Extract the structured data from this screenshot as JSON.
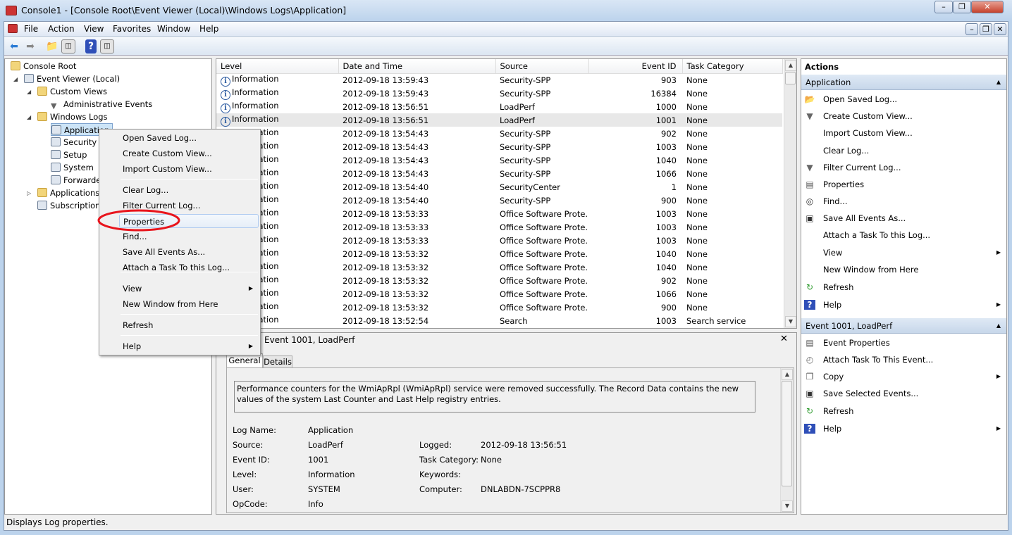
{
  "window": {
    "title": "Console1 - [Console Root\\Event Viewer (Local)\\Windows Logs\\Application]",
    "minimize": "–",
    "restore": "❐",
    "close": "✕"
  },
  "menubar": {
    "items": [
      "File",
      "Action",
      "View",
      "Favorites",
      "Window",
      "Help"
    ],
    "mdi": [
      "–",
      "❐",
      "✕"
    ]
  },
  "toolbar": {
    "buttons": [
      "back-icon",
      "forward-icon",
      "up-folder-icon",
      "show-hide-tree-icon",
      "help-icon",
      "show-hide-action-pane-icon"
    ]
  },
  "tree": {
    "items": [
      {
        "label": "Console Root",
        "icon": "folder-icon"
      },
      {
        "label": "Event Viewer (Local)",
        "icon": "event-viewer-icon"
      },
      {
        "label": "Custom Views",
        "icon": "folder-icon"
      },
      {
        "label": "Administrative Events",
        "icon": "filter-icon"
      },
      {
        "label": "Windows Logs",
        "icon": "folder-icon"
      },
      {
        "label": "Application",
        "icon": "log-icon"
      },
      {
        "label": "Security",
        "icon": "log-icon"
      },
      {
        "label": "Setup",
        "icon": "log-icon"
      },
      {
        "label": "System",
        "icon": "log-icon"
      },
      {
        "label": "Forwarded Events",
        "icon": "log-icon"
      },
      {
        "label": "Applications and Services Logs",
        "icon": "folder-icon"
      },
      {
        "label": "Subscriptions",
        "icon": "subscriptions-icon"
      }
    ]
  },
  "events": {
    "columns": [
      "Level",
      "Date and Time",
      "Source",
      "Event ID",
      "Task Category"
    ],
    "rows": [
      [
        "Information",
        "2012-09-18 13:59:43",
        "Security-SPP",
        "903",
        "None"
      ],
      [
        "Information",
        "2012-09-18 13:59:43",
        "Security-SPP",
        "16384",
        "None"
      ],
      [
        "Information",
        "2012-09-18 13:56:51",
        "LoadPerf",
        "1000",
        "None"
      ],
      [
        "Information",
        "2012-09-18 13:56:51",
        "LoadPerf",
        "1001",
        "None"
      ],
      [
        "Information",
        "2012-09-18 13:54:43",
        "Security-SPP",
        "902",
        "None"
      ],
      [
        "Information",
        "2012-09-18 13:54:43",
        "Security-SPP",
        "1003",
        "None"
      ],
      [
        "Information",
        "2012-09-18 13:54:43",
        "Security-SPP",
        "1040",
        "None"
      ],
      [
        "Information",
        "2012-09-18 13:54:43",
        "Security-SPP",
        "1066",
        "None"
      ],
      [
        "Information",
        "2012-09-18 13:54:40",
        "SecurityCenter",
        "1",
        "None"
      ],
      [
        "Information",
        "2012-09-18 13:54:40",
        "Security-SPP",
        "900",
        "None"
      ],
      [
        "Information",
        "2012-09-18 13:53:33",
        "Office Software Prote...",
        "1003",
        "None"
      ],
      [
        "Information",
        "2012-09-18 13:53:33",
        "Office Software Prote...",
        "1003",
        "None"
      ],
      [
        "Information",
        "2012-09-18 13:53:33",
        "Office Software Prote...",
        "1003",
        "None"
      ],
      [
        "Information",
        "2012-09-18 13:53:32",
        "Office Software Prote...",
        "1040",
        "None"
      ],
      [
        "Information",
        "2012-09-18 13:53:32",
        "Office Software Prote...",
        "1040",
        "None"
      ],
      [
        "Information",
        "2012-09-18 13:53:32",
        "Office Software Prote...",
        "902",
        "None"
      ],
      [
        "Information",
        "2012-09-18 13:53:32",
        "Office Software Prote...",
        "1066",
        "None"
      ],
      [
        "Information",
        "2012-09-18 13:53:32",
        "Office Software Prote...",
        "900",
        "None"
      ],
      [
        "Information",
        "2012-09-18 13:52:54",
        "Search",
        "1003",
        "Search service"
      ]
    ],
    "selected_index": 3
  },
  "detail": {
    "title": "Event 1001, LoadPerf",
    "tabs": [
      "General",
      "Details"
    ],
    "message": "Performance counters for the WmiApRpl (WmiApRpl) service were removed successfully. The Record Data contains the new values of the system Last Counter and Last Help registry entries.",
    "fields": {
      "log_name_label": "Log Name:",
      "log_name": "Application",
      "source_label": "Source:",
      "source": "LoadPerf",
      "logged_label": "Logged:",
      "logged": "2012-09-18 13:56:51",
      "event_id_label": "Event ID:",
      "event_id": "1001",
      "task_label": "Task Category:",
      "task": "None",
      "level_label": "Level:",
      "level": "Information",
      "keywords_label": "Keywords:",
      "user_label": "User:",
      "user": "SYSTEM",
      "computer_label": "Computer:",
      "computer": "DNLABDN-7SCPPR8",
      "opcode_label": "OpCode:",
      "opcode": "Info"
    }
  },
  "context_menu": {
    "items": [
      "Open Saved Log...",
      "Create Custom View...",
      "Import Custom View...",
      "Clear Log...",
      "Filter Current Log...",
      "Properties",
      "Find...",
      "Save All Events As...",
      "Attach a Task To this Log...",
      "View",
      "New Window from Here",
      "Refresh",
      "Help"
    ],
    "highlighted": "Properties",
    "annotation_color": "#e8141c"
  },
  "actions": {
    "title": "Actions",
    "section1": {
      "title": "Application",
      "items": [
        {
          "label": "Open Saved Log...",
          "icon": "open-icon"
        },
        {
          "label": "Create Custom View...",
          "icon": "filter-icon"
        },
        {
          "label": "Import Custom View...",
          "icon": ""
        },
        {
          "label": "Clear Log...",
          "icon": ""
        },
        {
          "label": "Filter Current Log...",
          "icon": "filter-icon"
        },
        {
          "label": "Properties",
          "icon": "properties-icon"
        },
        {
          "label": "Find...",
          "icon": "find-icon"
        },
        {
          "label": "Save All Events As...",
          "icon": "save-icon"
        },
        {
          "label": "Attach a Task To this Log...",
          "icon": ""
        },
        {
          "label": "View",
          "icon": ""
        },
        {
          "label": "New Window from Here",
          "icon": ""
        },
        {
          "label": "Refresh",
          "icon": "refresh-icon"
        },
        {
          "label": "Help",
          "icon": "help-icon"
        }
      ]
    },
    "section2": {
      "title": "Event 1001, LoadPerf",
      "items": [
        {
          "label": "Event Properties",
          "icon": "properties-icon"
        },
        {
          "label": "Attach Task To This Event...",
          "icon": "task-icon"
        },
        {
          "label": "Copy",
          "icon": "copy-icon"
        },
        {
          "label": "Save Selected Events...",
          "icon": "save-icon"
        },
        {
          "label": "Refresh",
          "icon": "refresh-icon"
        },
        {
          "label": "Help",
          "icon": "help-icon"
        }
      ]
    }
  },
  "status": {
    "text": "Displays Log properties."
  }
}
